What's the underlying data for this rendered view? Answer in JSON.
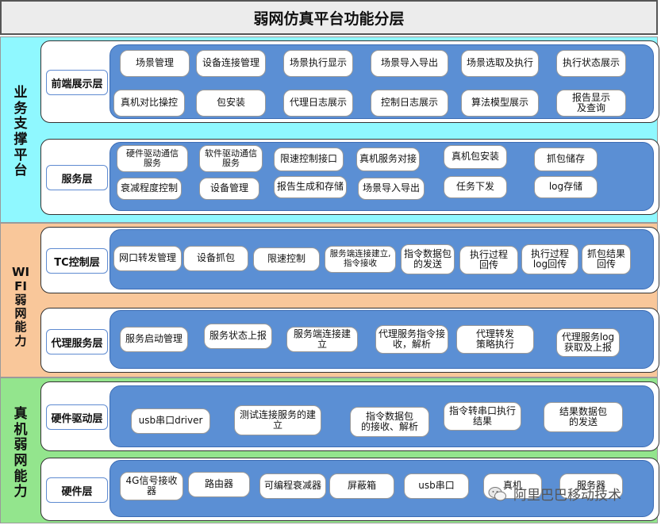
{
  "title": "弱网仿真平台功能分层",
  "colors": {
    "band_business": "#8ff8ff",
    "band_wifi": "#f9c79a",
    "band_device": "#93e58d",
    "panel": "#5b8fd4"
  },
  "bands": [
    {
      "id": "business",
      "label": [
        "业",
        "务",
        "支",
        "撑",
        "平",
        "台"
      ],
      "layers": [
        {
          "label": "前端展示层",
          "items": [
            "场景管理",
            "设备连接管理",
            "场景执行显示",
            "场景导入导出",
            "场景选取及执行",
            "执行状态展示",
            "真机对比操控",
            "包安装",
            "代理日志展示",
            "控制日志展示",
            "算法模型展示",
            "报告显示\n及查询"
          ]
        },
        {
          "label": "服务层",
          "items": [
            "硬件驱动通信\n服务",
            "软件驱动通信\n服务",
            "限速控制接口",
            "真机服务对接",
            "真机包安装",
            "抓包储存",
            "衰减程度控制",
            "设备管理",
            "报告生成和存储",
            "场景导入导出",
            "任务下发",
            "log存储"
          ]
        }
      ]
    },
    {
      "id": "wifi",
      "label": [
        "WI",
        "FI",
        "弱",
        "网",
        "能",
        "力"
      ],
      "layers": [
        {
          "label": "TC控制层",
          "items": [
            "网口转发管理",
            "设备抓包",
            "限速控制",
            "服务端连接建立,\n指令接收",
            "指令数据包\n的发送",
            "执行过程\n回传",
            "执行过程\nlog回传",
            "抓包结果\n回传"
          ]
        },
        {
          "label": "代理服务层",
          "items": [
            "服务启动管理",
            "服务状态上报",
            "服务端连接建立",
            "代理服务指令接\n收，解析",
            "代理转发\n策略执行",
            "代理服务log\n获取及上报"
          ]
        }
      ]
    },
    {
      "id": "device",
      "label": [
        "真",
        "机",
        "弱",
        "网",
        "能",
        "力"
      ],
      "layers": [
        {
          "label": "硬件驱动层",
          "items": [
            "usb串口driver",
            "测试连接服务的建\n立",
            "指令数据包\n的接收、解析",
            "指令转串口执行\n结果",
            "结果数据包\n的发送"
          ]
        },
        {
          "label": "硬件层",
          "items": [
            "4G信号接收\n器",
            "路由器",
            "可编程衰减器",
            "屏蔽箱",
            "usb串口",
            "真机",
            "服务器"
          ]
        }
      ]
    }
  ],
  "watermark": {
    "text": "阿里巴巴移动技术",
    "icon": "wechat-icon"
  }
}
